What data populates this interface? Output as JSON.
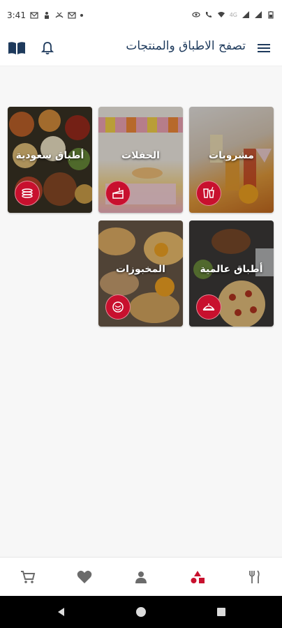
{
  "status_bar": {
    "time": "3:41",
    "network_label": "4G"
  },
  "app_bar": {
    "title": "تصفح الاطباق والمنتجات",
    "menu_icon": "hamburger-menu-icon",
    "book_icon": "book-icon",
    "bell_icon": "bell-icon"
  },
  "categories": [
    {
      "label": "مشروبات",
      "icon": "drinks-icon"
    },
    {
      "label": "الحفلات",
      "icon": "cake-icon"
    },
    {
      "label": "أطباق سعودية",
      "icon": "pancake-stack-icon"
    },
    {
      "label": "أطباق عالمية",
      "icon": "serving-dish-icon"
    },
    {
      "label": "المخبوزات",
      "icon": "bread-icon"
    }
  ],
  "bottom_nav": {
    "items": [
      "cart-icon",
      "heart-icon",
      "person-icon",
      "categories-icon",
      "cutlery-icon"
    ],
    "active": "categories-icon",
    "active_color": "#c8102e",
    "inactive_color": "#6b6b6b"
  },
  "colors": {
    "accent": "#c8102e",
    "title": "#1e3a5c"
  }
}
